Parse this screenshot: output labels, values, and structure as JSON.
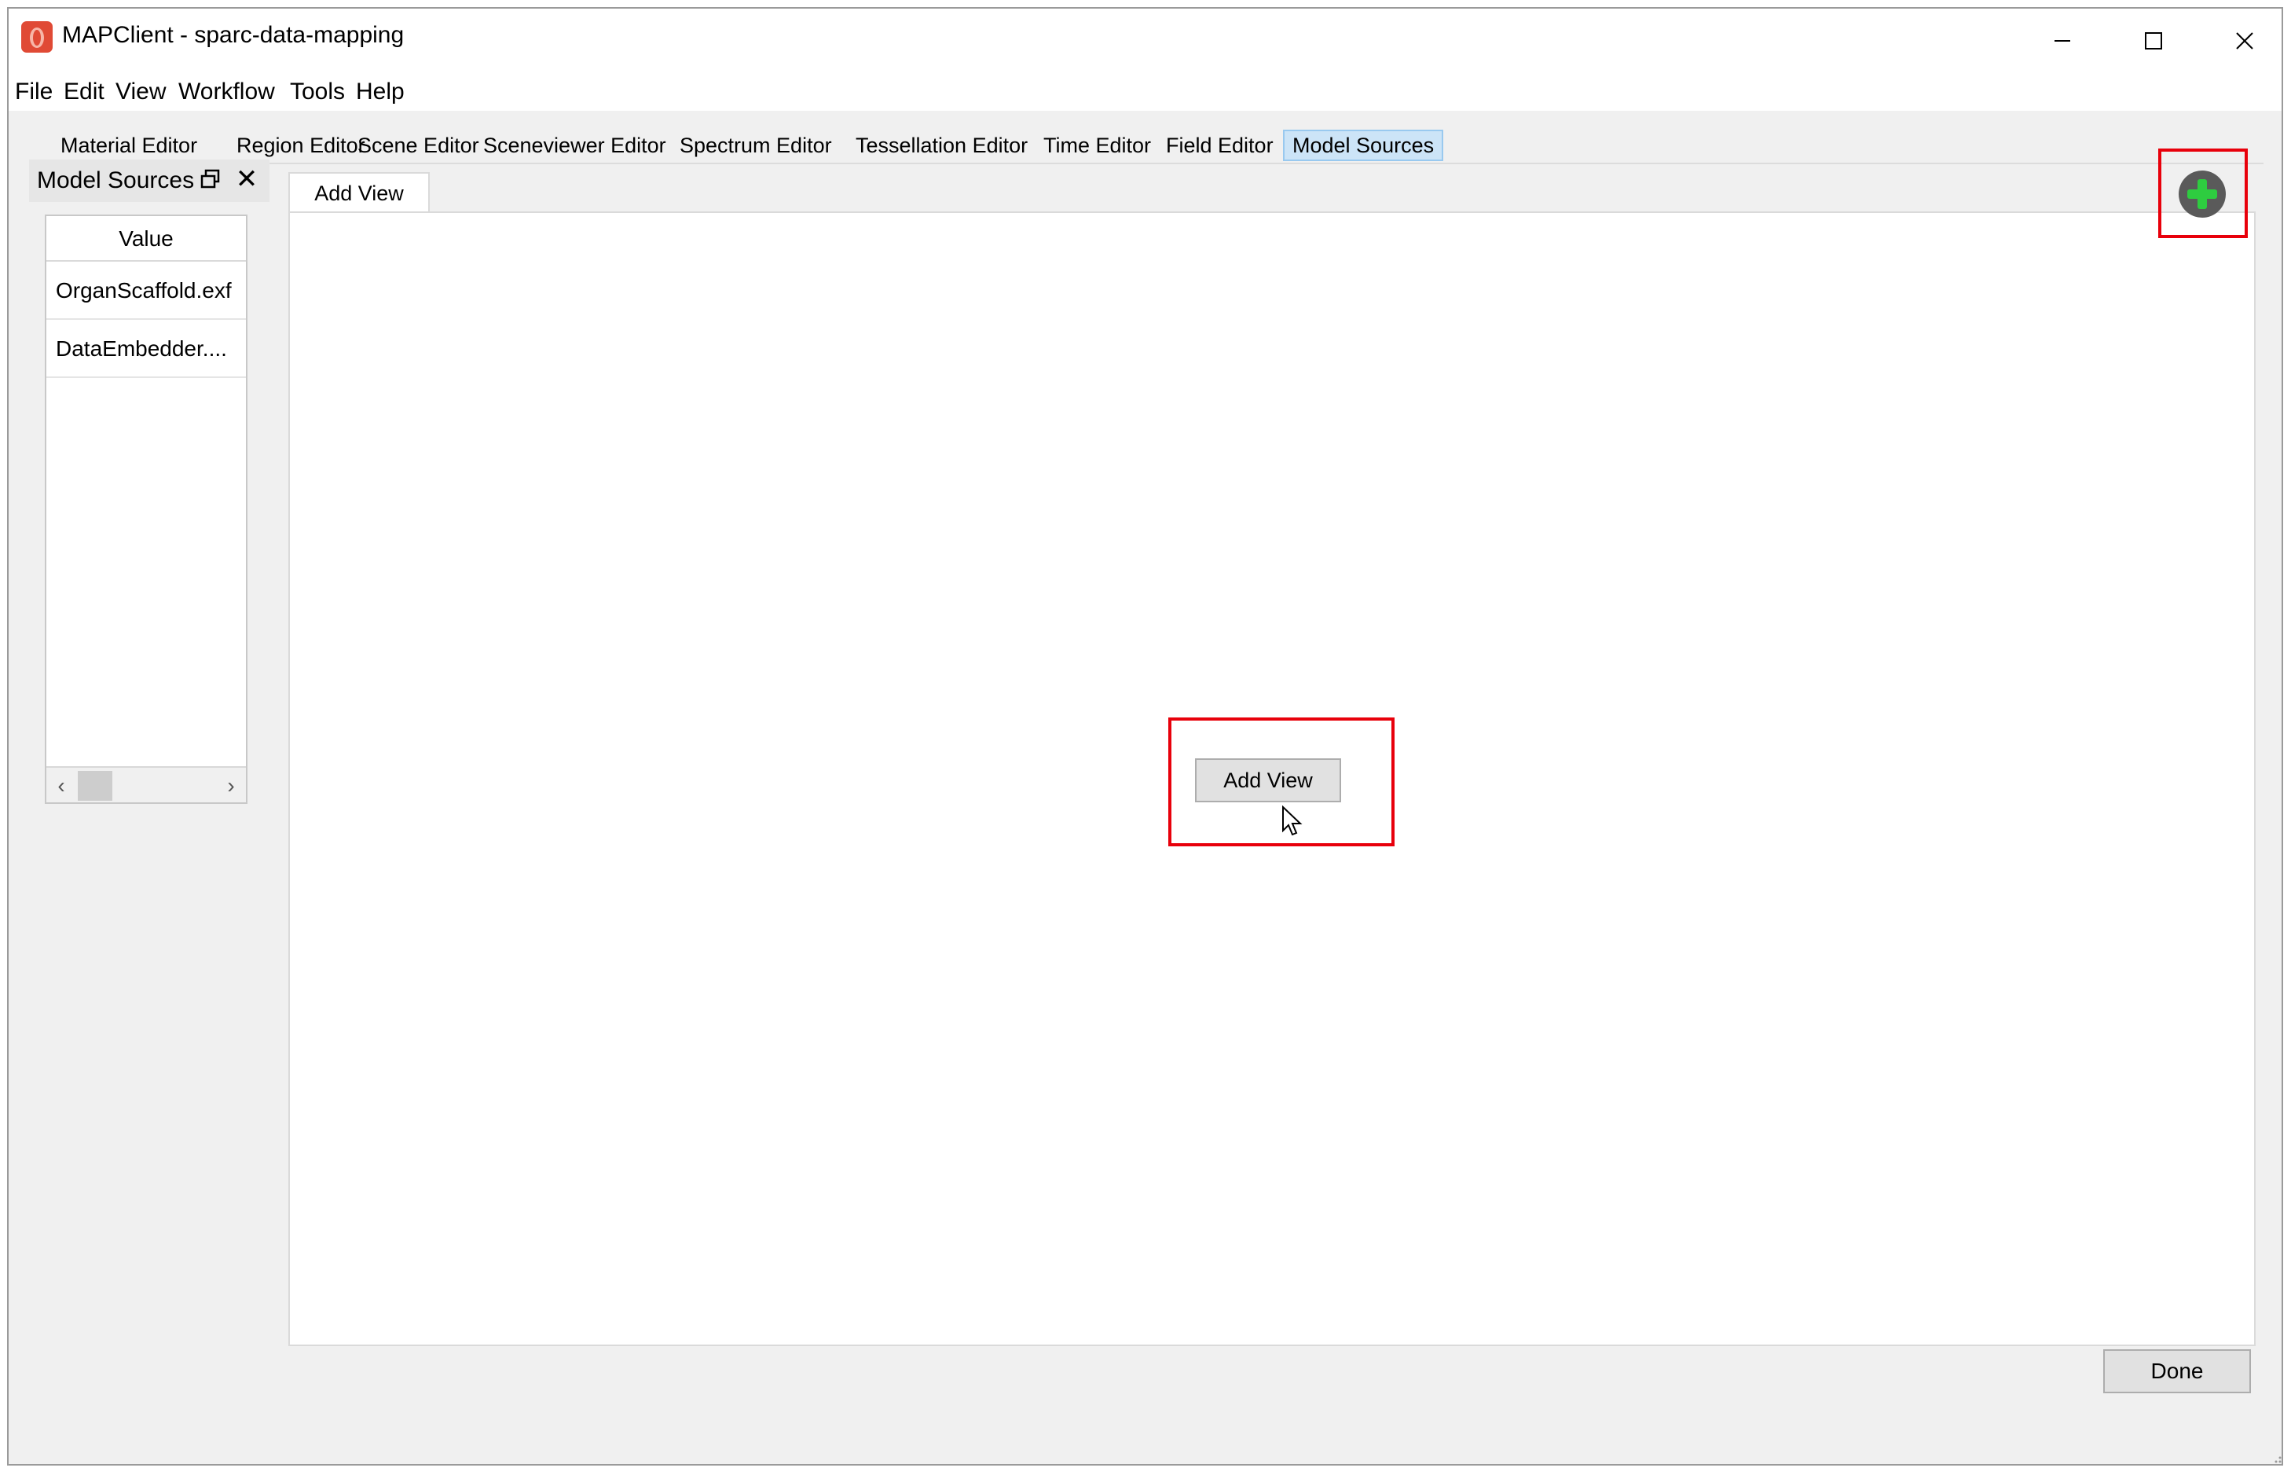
{
  "window": {
    "title": "MAPClient - sparc-data-mapping",
    "icon": "mapclient-app-icon"
  },
  "window_controls": {
    "minimize": "minimize-icon",
    "maximize": "maximize-icon",
    "close": "close-icon"
  },
  "menubar": {
    "items": [
      {
        "label": "File"
      },
      {
        "label": "Edit"
      },
      {
        "label": "View"
      },
      {
        "label": "Workflow"
      },
      {
        "label": "Tools"
      },
      {
        "label": "Help"
      }
    ]
  },
  "toolbar_tabs": {
    "items": [
      {
        "label": "Material Editor"
      },
      {
        "label": "Region Editor"
      },
      {
        "label": "Scene Editor"
      },
      {
        "label": "Sceneviewer Editor"
      },
      {
        "label": "Spectrum Editor"
      },
      {
        "label": "Tessellation Editor"
      },
      {
        "label": "Time Editor"
      },
      {
        "label": "Field Editor"
      },
      {
        "label": "Model Sources",
        "active": true
      }
    ]
  },
  "dock": {
    "title": "Model Sources",
    "float_icon": "float-window-icon",
    "close_label": "✕",
    "table": {
      "header": "Value",
      "rows": [
        {
          "value": "OrganScaffold.exf"
        },
        {
          "value": "DataEmbedder...."
        }
      ]
    },
    "scrollbar": {
      "left_arrow": "‹",
      "right_arrow": "›"
    }
  },
  "content": {
    "tab_label": "Add View",
    "center_button_label": "Add View",
    "add_icon": "green-plus-icon",
    "done_label": "Done"
  },
  "colors": {
    "highlight": "#e8000b",
    "active_tab": "#cce4f7",
    "plus_green": "#2ecc40",
    "app_icon": "#e04a35"
  }
}
